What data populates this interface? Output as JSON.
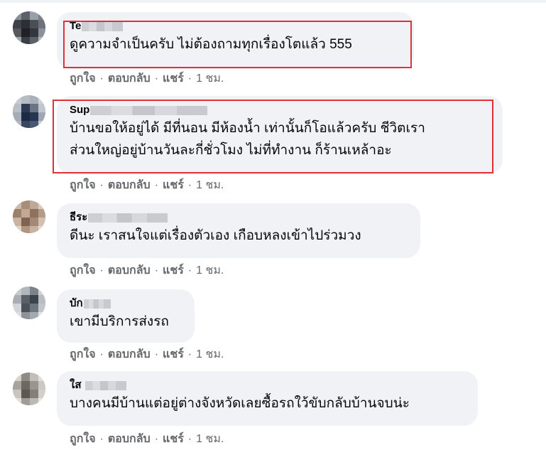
{
  "comments": [
    {
      "author_visible": "Te",
      "text": "ดูความจำเป็นครับ ไม่ต้องถามทุกเรื่องโตแล้ว 555",
      "highlighted": true
    },
    {
      "author_visible": "Sup",
      "text": "บ้านขอให้อยู่ได้ มีที่นอน มีห้องน้ำ เท่านั้นก็โอแล้วครับ ชีวิตเรา\nส่วนใหญ่อยู่บ้านวันละกี่ชั่วโมง ไม่ที่ทำงาน ก็ร้านเหล้าอะ",
      "highlighted": true
    },
    {
      "author_visible": "ธีระ",
      "text": "ดีนะ เราสนใจแต่เรื่องตัวเอง เกือบหลงเข้าไปร่วมวง",
      "highlighted": false
    },
    {
      "author_visible": "บัก",
      "text": "เขามีบริการส่งรถ",
      "highlighted": false
    },
    {
      "author_visible": "ใส",
      "text": "บางคนมีบ้านแต่อยู่ต่างจังหวัดเลยซื้อรถใว้ขับกลับบ้านจบน่ะ",
      "highlighted": false
    }
  ],
  "actions": {
    "like": "ถูกใจ",
    "reply": "ตอบกลับ",
    "share": "แชร์",
    "separator": "·",
    "time": "1 ชม."
  },
  "colors": {
    "bubble": "#f0f2f5",
    "highlight_border": "#e0303a",
    "meta_text": "#65676b"
  }
}
